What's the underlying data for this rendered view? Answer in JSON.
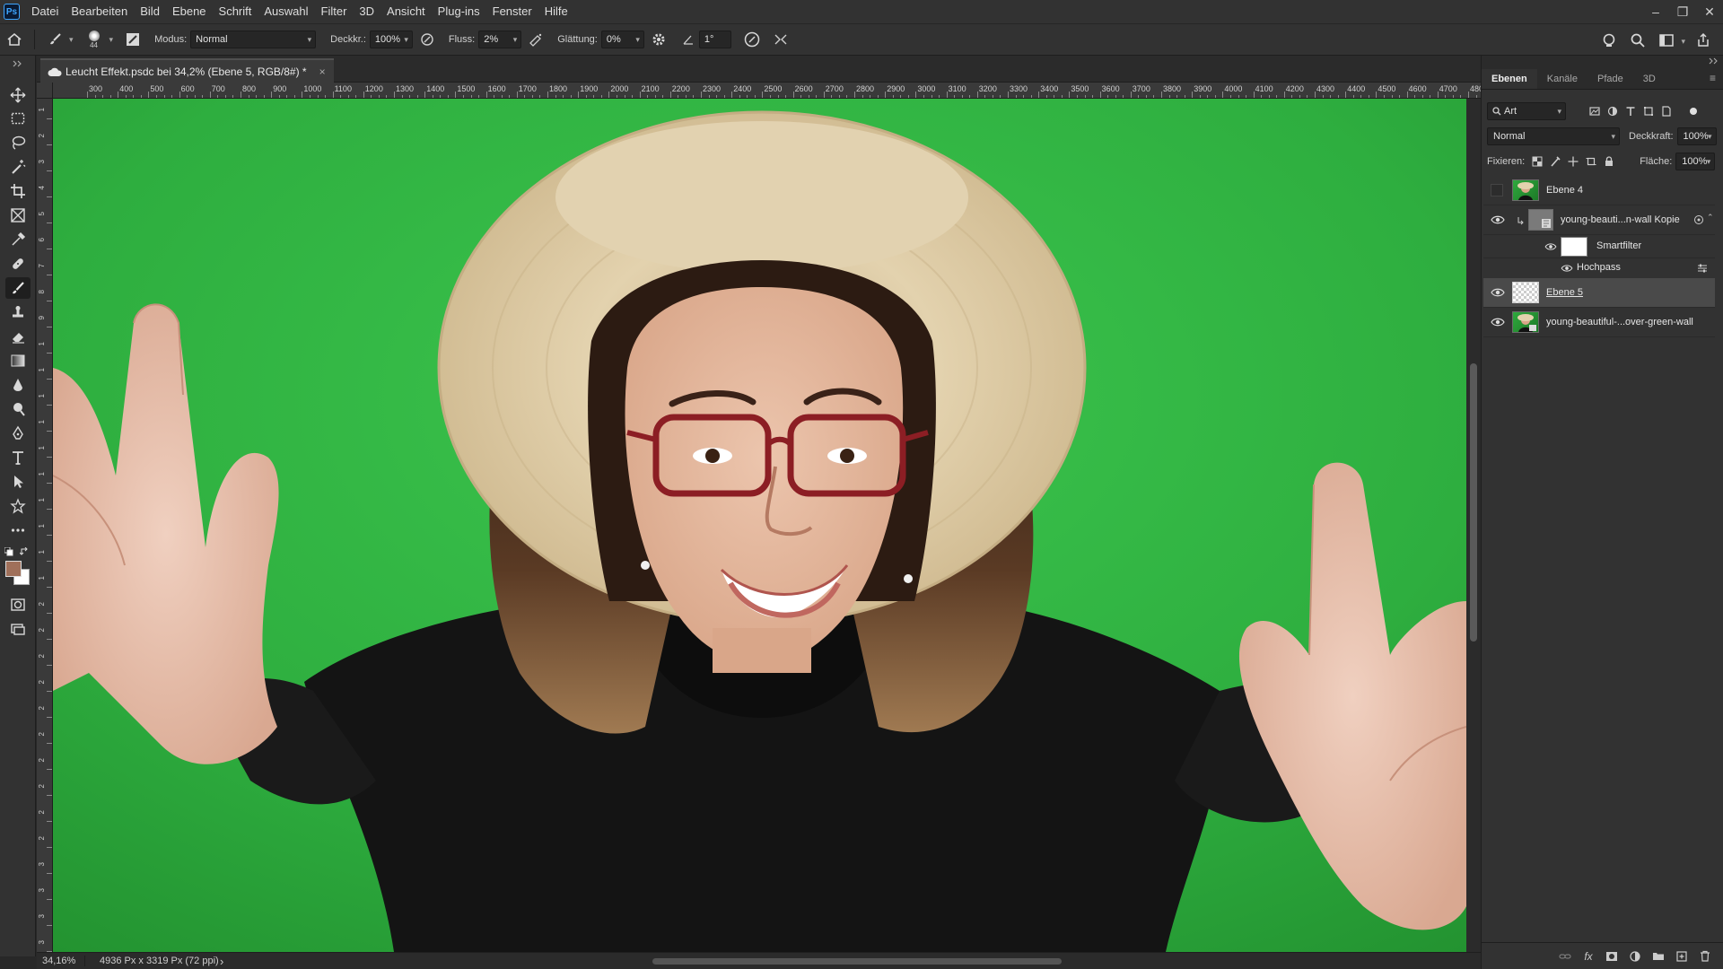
{
  "app": {
    "logo": "Ps"
  },
  "menu": [
    "Datei",
    "Bearbeiten",
    "Bild",
    "Ebene",
    "Schrift",
    "Auswahl",
    "Filter",
    "3D",
    "Ansicht",
    "Plug-ins",
    "Fenster",
    "Hilfe"
  ],
  "window_controls": {
    "minimize": "–",
    "restore": "❐",
    "close": "✕"
  },
  "options": {
    "brush_size": "44",
    "mode_label": "Modus:",
    "mode_value": "Normal",
    "opacity_label": "Deckkr.:",
    "opacity_value": "100%",
    "flow_label": "Fluss:",
    "flow_value": "2%",
    "smoothing_label": "Glättung:",
    "smoothing_value": "0%",
    "angle_value": "1°"
  },
  "document": {
    "tab_title": "Leucht Effekt.psdc bei 34,2% (Ebene 5, RGB/8#) *",
    "tab_close": "×",
    "ruler_h": [
      "300",
      "400",
      "500",
      "600",
      "700",
      "800",
      "900",
      "1000",
      "1100",
      "1200",
      "1300",
      "1400",
      "1500",
      "1600",
      "1700",
      "1800",
      "1900",
      "2000",
      "2100",
      "2200",
      "2300",
      "2400",
      "2500",
      "2600",
      "2700",
      "2800",
      "2900",
      "3000",
      "3100",
      "3200",
      "3300",
      "3400",
      "3500",
      "3600",
      "3700",
      "3800",
      "3900",
      "4000",
      "4100",
      "4200",
      "4300",
      "4400",
      "4500",
      "4600",
      "4700",
      "480"
    ],
    "ruler_v": [
      "1",
      "2",
      "3",
      "4",
      "5",
      "6",
      "7",
      "8",
      "9",
      "1",
      "1",
      "1",
      "1",
      "1",
      "1",
      "1",
      "1",
      "1",
      "1",
      "2",
      "2",
      "2",
      "2",
      "2",
      "2",
      "2",
      "2",
      "2",
      "2",
      "3",
      "3",
      "3",
      "3"
    ]
  },
  "status": {
    "zoom": "34,16%",
    "doc_info": "4936 Px x 3319 Px (72 ppi)",
    "arrow": "›"
  },
  "panel": {
    "tabs": [
      "Ebenen",
      "Kanäle",
      "Pfade",
      "3D"
    ],
    "active_tab": 0,
    "filter_kind": "Art",
    "blend_mode": "Normal",
    "opacity_label": "Deckkraft:",
    "opacity_value": "100%",
    "lock_label": "Fixieren:",
    "fill_label": "Fläche:",
    "fill_value": "100%",
    "layers": [
      {
        "name": "Ebene 4",
        "visible": false
      },
      {
        "name": "young-beauti...n-wall Kopie",
        "visible": true
      },
      {
        "name": "Smartfilter",
        "visible": true
      },
      {
        "name": "Hochpass",
        "visible": true
      },
      {
        "name": "Ebene 5",
        "visible": true,
        "selected": true
      },
      {
        "name": "young-beautiful-...over-green-wall",
        "visible": true
      }
    ]
  },
  "colors": {
    "foreground": "#a0705a",
    "background": "#ffffff",
    "canvas_green": "#2fa83d",
    "accent": "#3ea6ff"
  }
}
